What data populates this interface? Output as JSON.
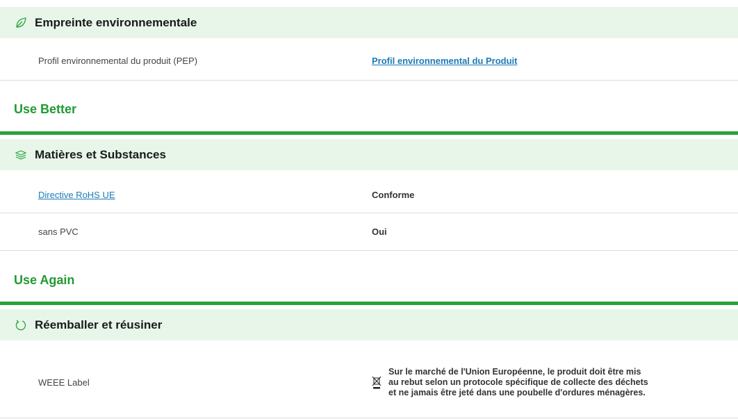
{
  "environmental_footprint": {
    "header": "Empreinte environnementale",
    "icon": "leaf-icon",
    "rows": [
      {
        "label": "Profil environnemental du produit (PEP)",
        "value": "Profil environnemental du Produit"
      }
    ]
  },
  "use_better": {
    "category": "Use Better",
    "header": "Matières et Substances",
    "icon": "layers-icon",
    "rows": [
      {
        "label": "Directive RoHS UE",
        "value": "Conforme"
      },
      {
        "label": "sans PVC",
        "value": "Oui"
      }
    ]
  },
  "use_again": {
    "category": "Use Again",
    "header": "Réemballer et réusiner",
    "icon": "cycle-icon",
    "rows": [
      {
        "label": "WEEE Label",
        "value": "Sur le marché de l'Union Européenne, le produit doit être mis au rebut selon un protocole spécifique de collecte des déchets et ne jamais être jeté dans une poubelle d'ordures ménagères.",
        "value_icon": "crossed-bin-icon"
      }
    ]
  },
  "colors": {
    "accent_green": "#229933",
    "header_bg": "#e8f6ea",
    "link_blue": "#1a7bb9"
  }
}
